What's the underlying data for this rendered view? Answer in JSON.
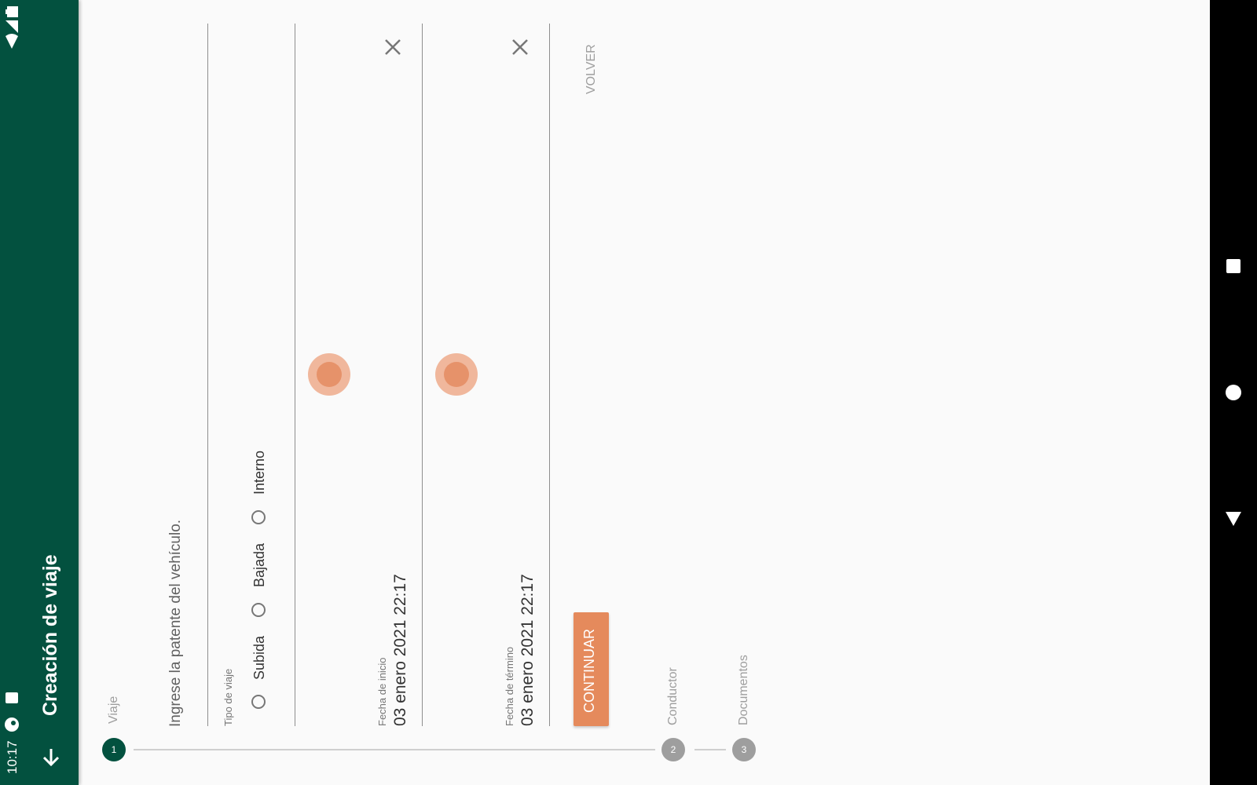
{
  "status_bar": {
    "time": "10:17"
  },
  "app_bar": {
    "title": "Creación de viaje"
  },
  "form": {
    "prompt": "Ingrese la patente del vehículo.",
    "trip_type": {
      "label": "Tipo de viaje",
      "options": [
        "Subida",
        "Bajada",
        "Interno"
      ]
    },
    "start_date": {
      "label": "Fecha de inicio",
      "value": "03 enero 2021 22:17"
    },
    "end_date": {
      "label": "Fecha de término",
      "value": "03 enero 2021 22:17"
    },
    "continue_label": "CONTINUAR",
    "back_label": "VOLVER"
  },
  "stepper": [
    {
      "number": "1",
      "label": "Viaje"
    },
    {
      "number": "2",
      "label": "Conductor"
    },
    {
      "number": "3",
      "label": "Documentos"
    }
  ],
  "colors": {
    "primary": "#03513f",
    "accent": "#e58a5c",
    "step_inactive": "#9e9e9e"
  }
}
